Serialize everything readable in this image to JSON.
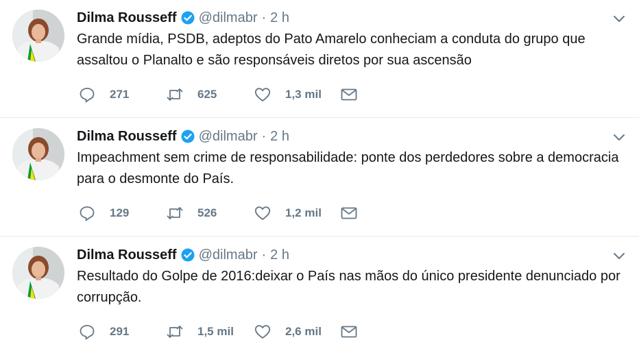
{
  "tweets": [
    {
      "name": "Dilma Rousseff",
      "handle": "@dilmabr",
      "separator": "·",
      "time": "2 h",
      "text": "Grande mídia, PSDB, adeptos do Pato Amarelo conheciam a conduta do grupo que assaltou o Planalto e são responsáveis diretos por sua ascensão",
      "replies": "271",
      "retweets": "625",
      "likes": "1,3 mil"
    },
    {
      "name": "Dilma Rousseff",
      "handle": "@dilmabr",
      "separator": "·",
      "time": "2 h",
      "text": "Impeachment sem crime de responsabilidade: ponte dos perdedores sobre a democracia para o desmonte do País.",
      "replies": "129",
      "retweets": "526",
      "likes": "1,2 mil"
    },
    {
      "name": "Dilma Rousseff",
      "handle": "@dilmabr",
      "separator": "·",
      "time": "2 h",
      "text": "Resultado do Golpe de 2016:deixar o País nas mãos do único presidente denunciado por corrupção.",
      "replies": "291",
      "retweets": "1,5 mil",
      "likes": "2,6 mil"
    }
  ],
  "icons": {
    "verified": "verified-badge-icon",
    "caret": "chevron-down-icon",
    "reply": "reply-icon",
    "retweet": "retweet-icon",
    "like": "heart-icon",
    "dm": "envelope-icon"
  },
  "colors": {
    "text": "#14171a",
    "muted": "#657786",
    "verified": "#1da1f2",
    "divider": "#e6ecf0"
  }
}
